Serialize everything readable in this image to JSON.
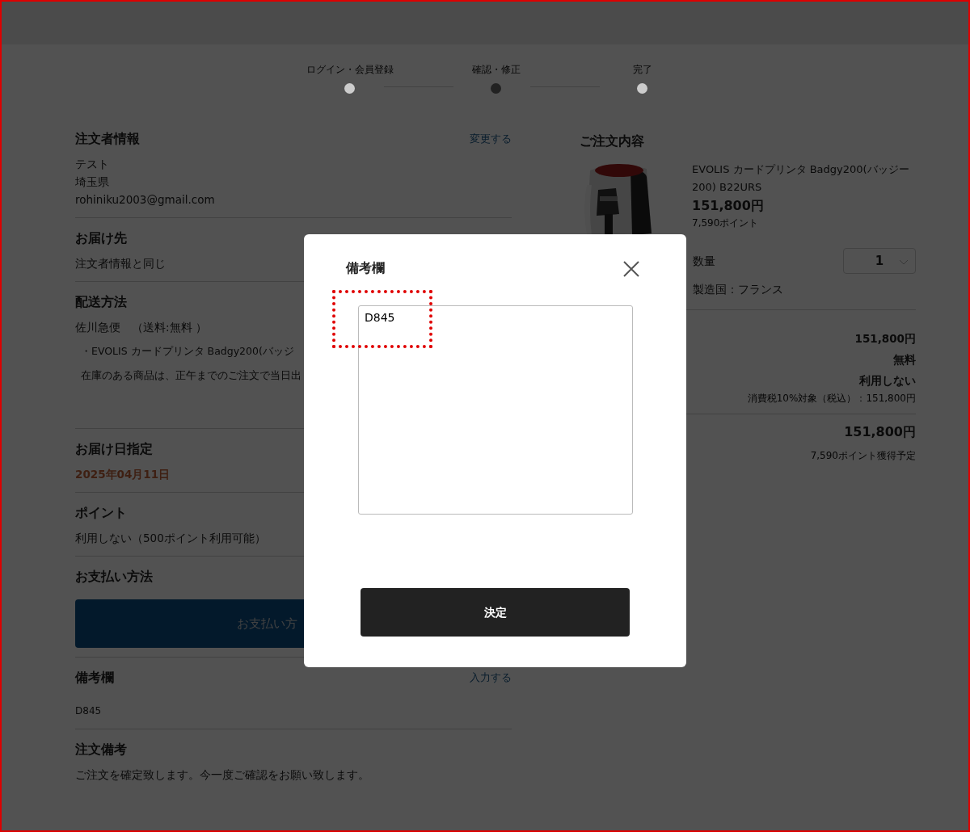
{
  "steps": [
    {
      "label": "ログイン・会員登録",
      "selected": false
    },
    {
      "label": "確認・修正",
      "selected": true
    },
    {
      "label": "完了",
      "selected": false
    }
  ],
  "sections": [
    {
      "title": "注文者情報",
      "action": "変更する",
      "lines": [
        {
          "kind": "text",
          "text": "テスト"
        },
        {
          "kind": "text",
          "text": "埼玉県"
        },
        {
          "kind": "text",
          "text": "rohiniku2003@gmail.com"
        }
      ]
    },
    {
      "title": "お届け先",
      "lines": [
        {
          "kind": "text",
          "text": "注文者情報と同じ"
        }
      ]
    },
    {
      "title": "配送方法",
      "lines": [
        {
          "kind": "text",
          "text": "佐川急便　（送料:無料 ）"
        },
        {
          "kind": "note",
          "text": "・EVOLIS カードプリンタ Badgy200(バッジ"
        },
        {
          "kind": "note",
          "text": "在庫のある商品は、正午までのご注文で当日出"
        }
      ]
    },
    {
      "title": "お届け日指定",
      "lines": [
        {
          "kind": "date",
          "text": "2025年04月11日"
        }
      ]
    },
    {
      "title": "ポイント",
      "lines": [
        {
          "kind": "text",
          "text": "利用しない（500ポイント利用可能）"
        }
      ]
    },
    {
      "title": "お支払い方法",
      "lines": [
        {
          "kind": "button",
          "text": "お支払い方"
        }
      ]
    },
    {
      "title": "備考欄",
      "action": "入力する",
      "lines": [
        {
          "kind": "small",
          "text": "D845"
        }
      ]
    },
    {
      "title": "注文備考",
      "lines": [
        {
          "kind": "text",
          "text": "ご注文を確定致します。今一度ご確認をお願い致します。"
        }
      ]
    }
  ],
  "order": {
    "title": "ご注文内容",
    "product": {
      "name": "EVOLIS カードプリンタ Badgy200(バッジー200) B22URS",
      "price": "151,800円",
      "points": "7,590ポイント",
      "quantity_label": "数量",
      "quantity": "1",
      "origin": "製造国：フランス"
    },
    "summary": [
      "151,800円",
      "無料",
      "利用しない"
    ],
    "tax_note": "消費税10%対象（税込）：151,800円",
    "total": "151,800円",
    "total_points": "7,590ポイント獲得予定"
  },
  "modal": {
    "title": "備考欄",
    "value": "D845",
    "value_highlighted": true,
    "button": "決定"
  }
}
